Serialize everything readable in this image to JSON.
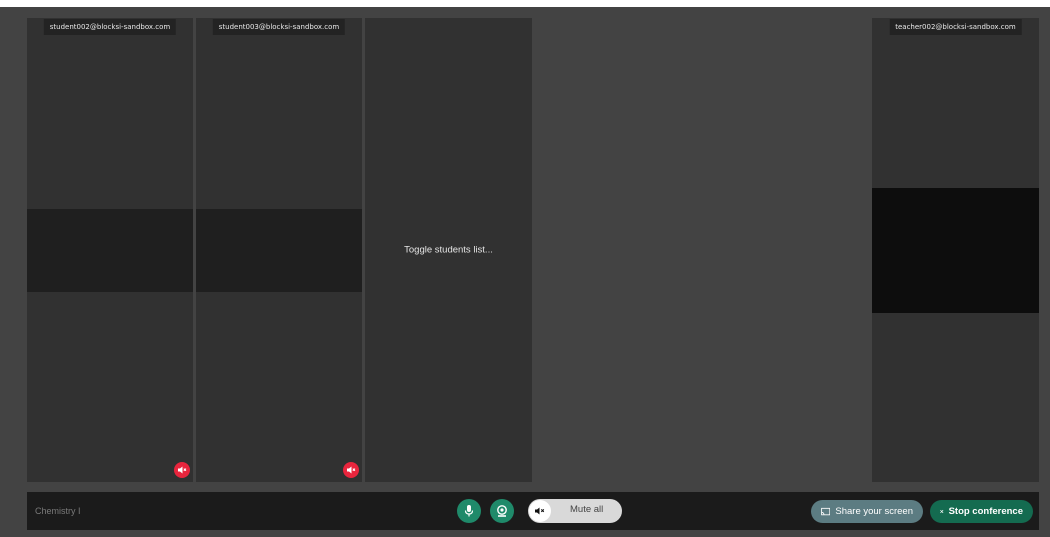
{
  "participants": [
    {
      "email": "student002@blocksi-sandbox.com",
      "muted": true,
      "icon": "speaker-muted-icon"
    },
    {
      "email": "student003@blocksi-sandbox.com",
      "muted": true,
      "icon": "speaker-muted-icon"
    }
  ],
  "students_panel": {
    "toggle_label": "Toggle students list..."
  },
  "teacher": {
    "email": "teacher002@blocksi-sandbox.com"
  },
  "toolbar": {
    "conference_title": "Chemistry I",
    "mic_icon": "microphone-icon",
    "camera_icon": "webcam-icon",
    "mute_all_label": "Mute all",
    "share_label": "Share your screen",
    "stop_label": "Stop conference"
  },
  "colors": {
    "stage_bg": "#434343",
    "tile_bg": "#313131",
    "muted_badge": "#e8253d",
    "accent_green": "#1f8a6a",
    "share_button": "#5c7c82",
    "stop_button": "#146b50"
  }
}
